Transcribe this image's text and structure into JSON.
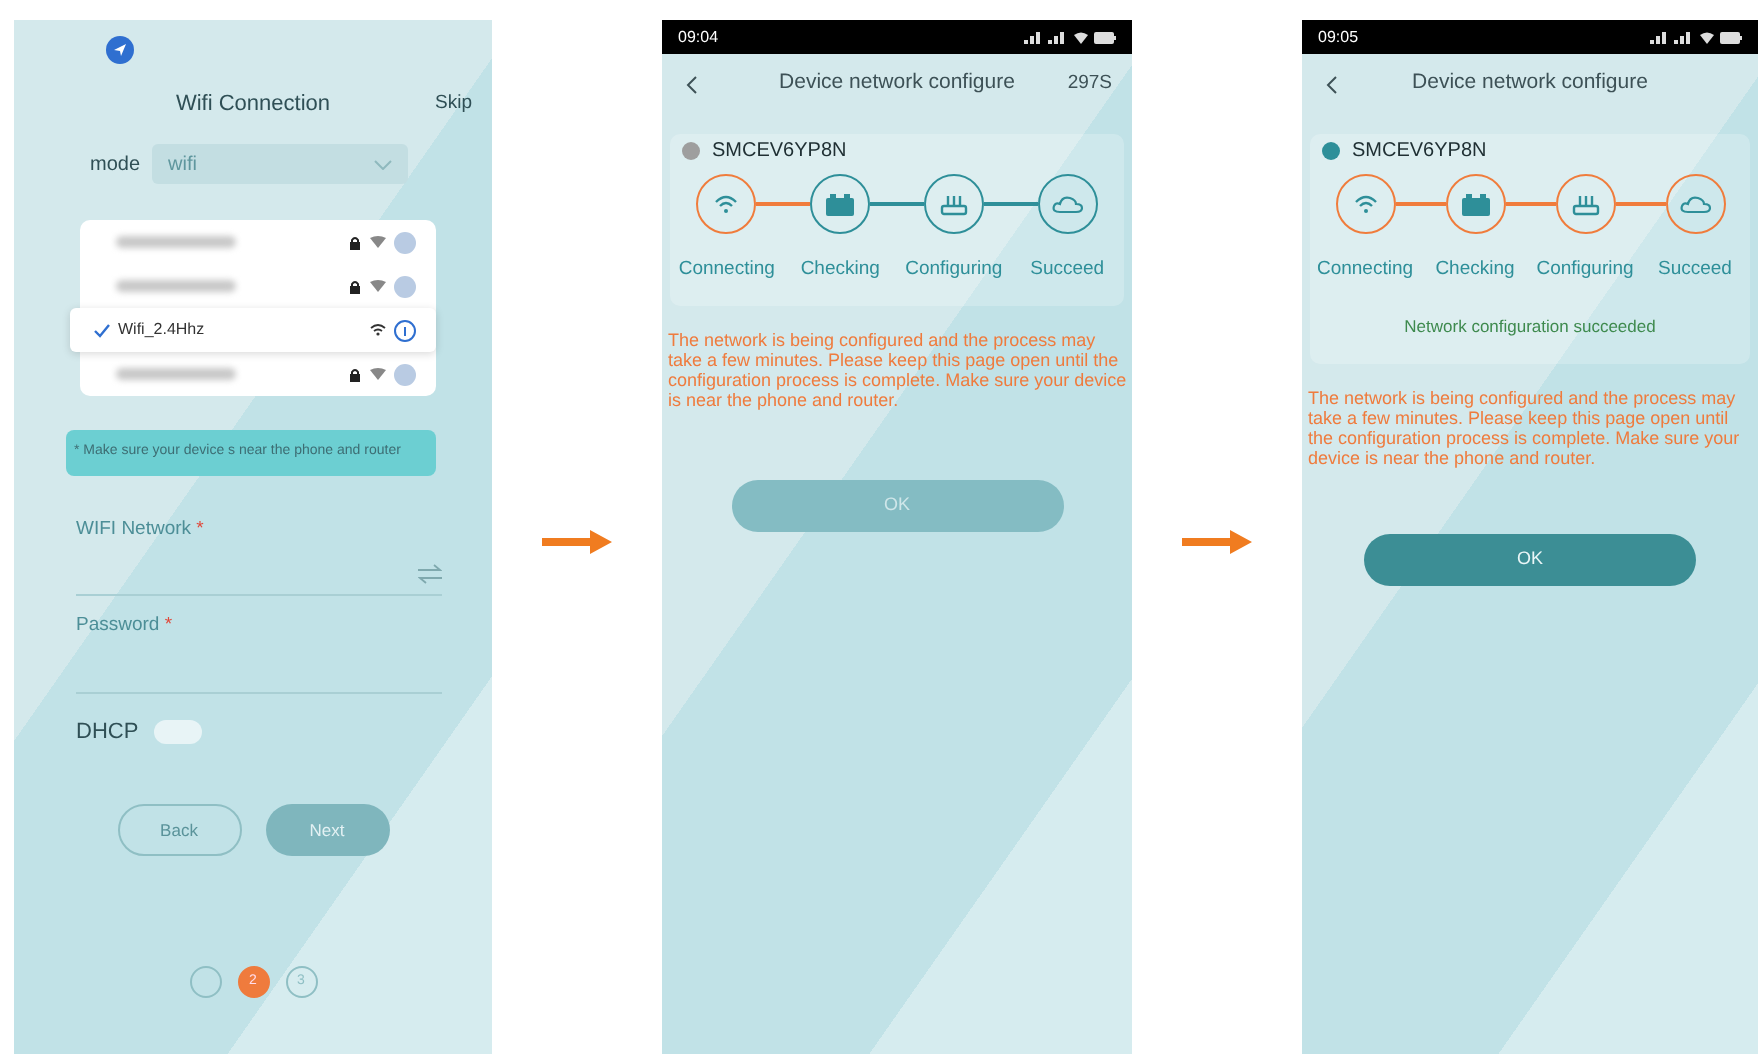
{
  "screens": [
    {
      "kind": "wifi_setup",
      "title": "Wifi Connection",
      "skip": "Skip",
      "mode": {
        "label": "mode",
        "value": "wifi"
      },
      "networks": [
        {
          "selected": false,
          "secured": true
        },
        {
          "selected": false,
          "secured": true
        },
        {
          "name": "Wifi_2.4Hhz",
          "selected": true,
          "secured": false
        },
        {
          "selected": false,
          "secured": true
        }
      ],
      "note": "* Make sure your device s near the phone and router",
      "fields": [
        {
          "label": "WIFI Network",
          "required_mark": "*"
        },
        {
          "label": "Password",
          "required_mark": "*"
        }
      ],
      "dhcp": {
        "label": "DHCP",
        "on": false
      },
      "buttons": [
        {
          "label": "Back",
          "kind": "outline"
        },
        {
          "label": "Next",
          "kind": "filled"
        }
      ],
      "pager": [
        {
          "selected": false
        },
        {
          "label": "2",
          "selected": true
        },
        {
          "label": "3",
          "selected": false
        }
      ]
    },
    {
      "kind": "progress",
      "time": "09:04",
      "title": "Device network configure",
      "countdown": "297S",
      "device": {
        "name": "SMCEV6YP8N",
        "color": "#9e9e9e"
      },
      "steps": [
        {
          "label": "Connecting",
          "done": true
        },
        {
          "label": "Checking",
          "done": false
        },
        {
          "label": "Configuring",
          "done": false
        },
        {
          "label": "Succeed",
          "done": false
        }
      ],
      "notice": "The network is being configured and the process may take a few minutes. Please keep this page open until the configuration process is complete. Make sure your device is near the phone and router.",
      "ok": {
        "label": "OK",
        "disabled": true
      }
    },
    {
      "kind": "progress",
      "time": "09:05",
      "title": "Device network configure",
      "device": {
        "name": "SMCEV6YP8N",
        "color": "#2e8f99"
      },
      "steps": [
        {
          "label": "Connecting",
          "done": true
        },
        {
          "label": "Checking",
          "done": true
        },
        {
          "label": "Configuring",
          "done": true
        },
        {
          "label": "Succeed",
          "done": true
        }
      ],
      "result": "Network configuration succeeded",
      "notice": "The network is being configured and the process may take a few minutes. Please keep this page open until the configuration process is complete. Make sure your device is near the phone and router.",
      "ok": {
        "label": "OK",
        "disabled": false
      }
    }
  ]
}
